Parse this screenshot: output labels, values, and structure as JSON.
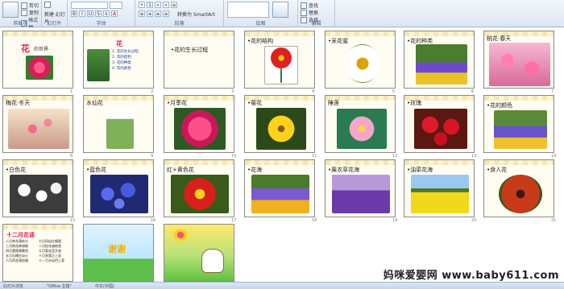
{
  "ribbon": {
    "clipboard_label": "剪贴板",
    "paste": "粘贴",
    "cut": "剪切",
    "copy": "复制",
    "format_painter": "格式刷",
    "slides_label": "幻灯片",
    "new_slide": "新建\n幻灯片",
    "layout": "版式",
    "reset": "重设",
    "delete": "删除",
    "font_label": "字体",
    "paragraph_label": "段落",
    "convert_smartart": "转换为 SmartArt",
    "drawing_label": "绘图",
    "find": "查找",
    "replace": "替换",
    "select": "选择",
    "editing_label": "编辑"
  },
  "slides": [
    {
      "n": "1",
      "title": "花",
      "subtitle": "的世界",
      "accent": "#e0224b"
    },
    {
      "n": "2",
      "title": "花",
      "bullets": [
        "1. 花的生长过程",
        "2. 花的结构",
        "3. 花的种类",
        "4. 花的颜色"
      ]
    },
    {
      "n": "3",
      "title": "•花的生长过程"
    },
    {
      "n": "4",
      "title": "•花的结构",
      "labels": [
        "花瓣",
        "雄蕊",
        "雌蕊",
        "花托",
        "花柄"
      ]
    },
    {
      "n": "5",
      "title": "•采花蜜"
    },
    {
      "n": "6",
      "title": "•花的种类"
    },
    {
      "n": "7",
      "title": "桃花·春天"
    },
    {
      "n": "8",
      "title": "梅花·冬天"
    },
    {
      "n": "9",
      "title": "水仙花"
    },
    {
      "n": "10",
      "title": "•月季花"
    },
    {
      "n": "11",
      "title": "•菊花"
    },
    {
      "n": "12",
      "title": "睡莲"
    },
    {
      "n": "13",
      "title": "•玫瑰"
    },
    {
      "n": "14",
      "title": "•花的颜色"
    },
    {
      "n": "15",
      "title": "•白色花"
    },
    {
      "n": "16",
      "title": "•蓝色花"
    },
    {
      "n": "17",
      "title": "红+黄色花"
    },
    {
      "n": "18",
      "title": "•花海"
    },
    {
      "n": "19",
      "title": "•薰衣草花海"
    },
    {
      "n": "20",
      "title": "•油菜花海"
    },
    {
      "n": "21",
      "title": "•食人花"
    },
    {
      "n": "22",
      "title": "十二月花谣",
      "poem_left": [
        "二月杏花满枝头",
        "三月桃花映绿柳",
        "四月蔷薇满篱笆",
        "五月石榴红似火",
        "六月荷花满池塘"
      ],
      "poem_right": [
        "七月凤仙红胭脂",
        "八月桂花遍地香",
        "九月菊花竞开放",
        "十月芙蓉正上妆",
        "十一月水仙供上案"
      ]
    },
    {
      "n": "23",
      "title": "谢谢"
    },
    {
      "n": "24",
      "title": ""
    }
  ],
  "status": {
    "theme": "\"Office 主题\"",
    "lang": "中文(中国)"
  },
  "watermark": "妈咪爱婴网 www.baby611.com"
}
